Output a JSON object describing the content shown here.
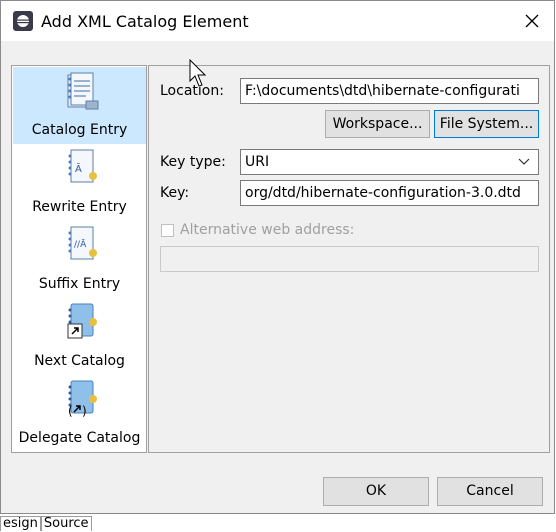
{
  "window": {
    "title": "Add XML Catalog Element"
  },
  "nav": {
    "items": [
      {
        "label": "Catalog Entry",
        "icon": "catalog-entry-icon"
      },
      {
        "label": "Rewrite Entry",
        "icon": "rewrite-entry-icon"
      },
      {
        "label": "Suffix Entry",
        "icon": "suffix-entry-icon"
      },
      {
        "label": "Next Catalog",
        "icon": "next-catalog-icon"
      },
      {
        "label": "Delegate Catalog",
        "icon": "delegate-catalog-icon"
      }
    ]
  },
  "form": {
    "location_label": "Location:",
    "location_value": "F:\\documents\\dtd\\hibernate-configurati",
    "workspace_button": "Workspace...",
    "filesystem_button": "File System...",
    "keytype_label": "Key type:",
    "keytype_value": "URI",
    "key_label": "Key:",
    "key_value": "org/dtd/hibernate-configuration-3.0.dtd",
    "alt_web_label": "Alternative web address:",
    "alt_web_value": ""
  },
  "footer": {
    "ok_label": "OK",
    "cancel_label": "Cancel"
  },
  "background": {
    "tab1": "esign",
    "tab2": "Source"
  },
  "colors": {
    "selection": "#cce8ff",
    "focus_border": "#0078d7"
  }
}
